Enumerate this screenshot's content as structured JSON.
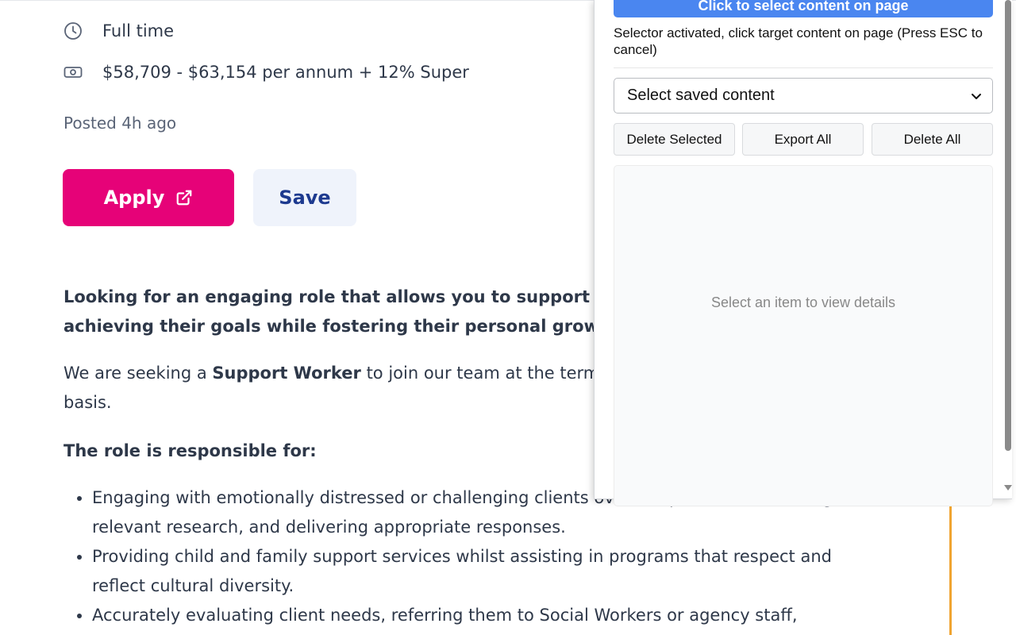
{
  "job": {
    "work_type": "Full time",
    "salary": "$58,709 - $63,154 per annum + 12% Super",
    "posted": "Posted 4h ago",
    "apply_label": "Apply",
    "save_label": "Save",
    "intro": "Looking for an engaging role that allows you to support achieving their goals while fostering their personal grow",
    "para_prefix": "We are seeking a ",
    "para_bold": "Support Worker",
    "para_suffix": " to join our team at the term basis.",
    "role_heading": "The role is responsible for:",
    "duties": [
      "Engaging with emotionally distressed or challenging clients over the phone, undertaking relevant research, and delivering appropriate responses.",
      "Providing child and family support services whilst assisting in programs that respect and reflect cultural diversity.",
      "Accurately evaluating client needs, referring them to Social Workers or agency staff,"
    ]
  },
  "extension": {
    "select_button": "Click to select content on page",
    "status": "Selector activated, click target content on page (Press ESC to cancel)",
    "dropdown_selected": "Select saved content",
    "delete_selected": "Delete Selected",
    "export_all": "Export All",
    "delete_all": "Delete All",
    "empty_message": "Select an item to view details"
  },
  "colors": {
    "apply_bg": "#e60278",
    "save_bg": "#eff3fb",
    "select_button_bg": "#4a86f0",
    "accent_line": "#f0a431"
  },
  "icons": {
    "work_type": "clock-icon",
    "salary": "money-icon",
    "apply": "external-link-icon",
    "dropdown": "chevron-down-icon"
  }
}
